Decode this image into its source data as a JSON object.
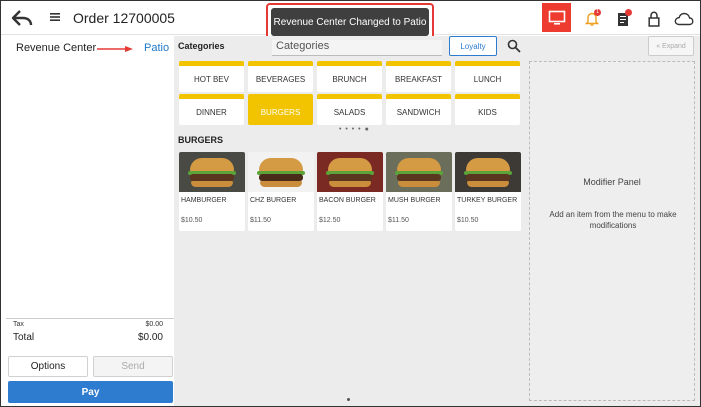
{
  "header": {
    "order_title": "Order 12700005",
    "toast": "Revenue Center Changed to Patio",
    "icons": [
      "back-arrow-icon",
      "hamburger-menu-icon",
      "monitor-icon",
      "bell-icon",
      "document-icon",
      "lock-icon",
      "cloud-icon"
    ],
    "notification_badge": "1",
    "accent_color": "#ee3b30"
  },
  "left": {
    "revenue_center_label": "Revenue Center",
    "revenue_center_value": "Patio",
    "tax_label": "Tax",
    "tax_value": "$0.00",
    "total_label": "Total",
    "total_value": "$0.00",
    "options_label": "Options",
    "send_label": "Send",
    "pay_label": "Pay"
  },
  "menu": {
    "categories_label": "Categories",
    "search_text": "Categories",
    "loyalty_label": "Loyalty",
    "categories": [
      {
        "label": "HOT BEV",
        "selected": false
      },
      {
        "label": "BEVERAGES",
        "selected": false
      },
      {
        "label": "BRUNCH",
        "selected": false
      },
      {
        "label": "BREAKFAST",
        "selected": false
      },
      {
        "label": "LUNCH",
        "selected": false
      },
      {
        "label": "DINNER",
        "selected": false
      },
      {
        "label": "BURGERS",
        "selected": true
      },
      {
        "label": "SALADS",
        "selected": false
      },
      {
        "label": "SANDWICH",
        "selected": false
      },
      {
        "label": "KIDS",
        "selected": false
      }
    ],
    "section_title": "BURGERS",
    "items": [
      {
        "name": "HAMBURGER",
        "price": "$10.50"
      },
      {
        "name": "CHZ BURGER",
        "price": "$11.50"
      },
      {
        "name": "BACON BURGER",
        "price": "$12.50"
      },
      {
        "name": "MUSH BURGER",
        "price": "$11.50"
      },
      {
        "name": "TURKEY BURGER",
        "price": "$10.50"
      }
    ],
    "category_color": "#f2c400"
  },
  "modifier": {
    "expand_label": "« Expand",
    "title": "Modifier Panel",
    "description": "Add an item from the menu to make modifications"
  }
}
